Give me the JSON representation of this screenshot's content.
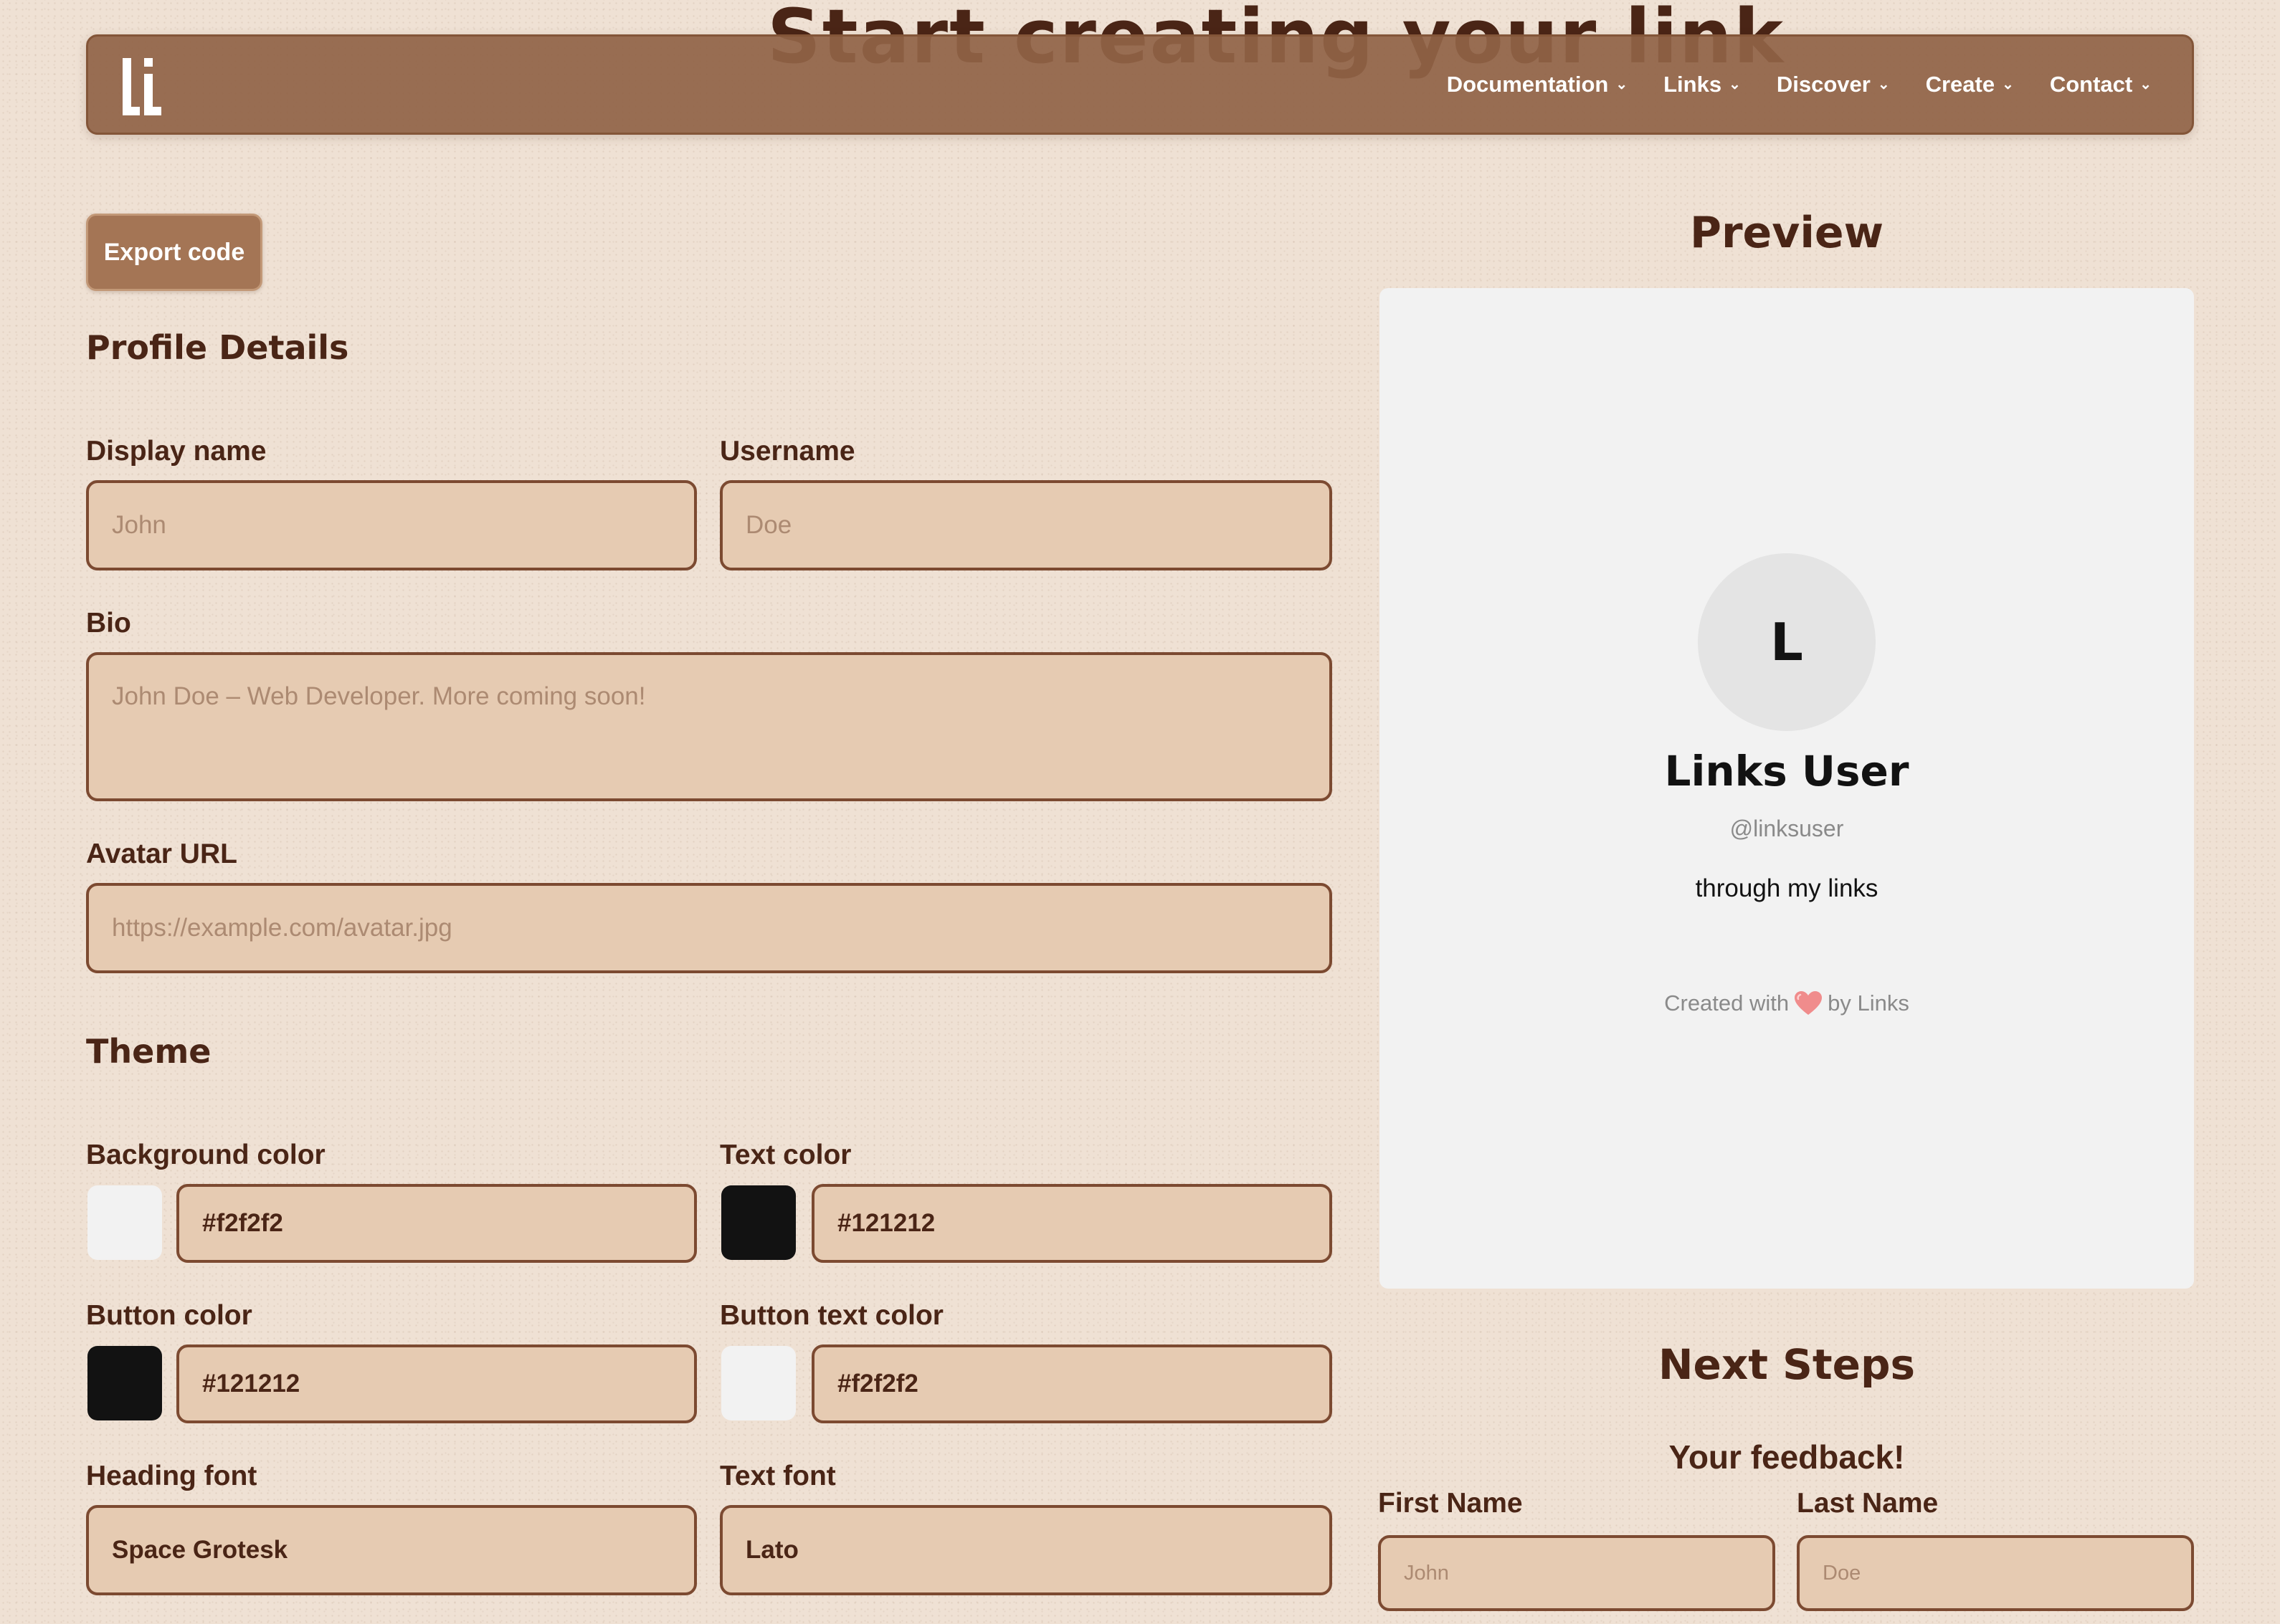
{
  "hero": {
    "title": "Start creating your link"
  },
  "nav": {
    "items": [
      {
        "label": "Documentation"
      },
      {
        "label": "Links"
      },
      {
        "label": "Discover"
      },
      {
        "label": "Create"
      },
      {
        "label": "Contact"
      }
    ]
  },
  "toolbar": {
    "export_label": "Export code"
  },
  "profile": {
    "title": "Profile Details",
    "display_name": {
      "label": "Display name",
      "placeholder": "John"
    },
    "username": {
      "label": "Username",
      "placeholder": "Doe"
    },
    "bio": {
      "label": "Bio",
      "placeholder": "John Doe – Web Developer. More coming soon!"
    },
    "avatar_url": {
      "label": "Avatar URL",
      "placeholder": "https://example.com/avatar.jpg"
    }
  },
  "theme": {
    "title": "Theme",
    "background_color": {
      "label": "Background color",
      "value": "#f2f2f2"
    },
    "text_color": {
      "label": "Text color",
      "value": "#121212"
    },
    "button_color": {
      "label": "Button color",
      "value": "#121212"
    },
    "button_text_color": {
      "label": "Button text color",
      "value": "#f2f2f2"
    },
    "heading_font": {
      "label": "Heading font",
      "value": "Space Grotesk"
    },
    "text_font": {
      "label": "Text font",
      "value": "Lato"
    }
  },
  "preview": {
    "title": "Preview",
    "avatar_initial": "L",
    "name": "Links User",
    "handle": "@linksuser",
    "bio": "through my links",
    "footer_prefix": "Created with",
    "footer_suffix": "by Links",
    "heart_icon": "heart-icon"
  },
  "next_steps": {
    "title": "Next Steps",
    "feedback_title": "Your feedback!",
    "first_name": {
      "label": "First Name",
      "placeholder": "John"
    },
    "last_name": {
      "label": "Last Name",
      "placeholder": "Doe"
    }
  },
  "colors": {
    "page_bg": "#efe1d4",
    "nav_bg": "#906346",
    "accent_brown": "#4a2516",
    "field_bg": "#e6cbb2",
    "field_border": "#7c4a31",
    "preview_bg": "#f2f2f2",
    "preview_text": "#121212"
  }
}
